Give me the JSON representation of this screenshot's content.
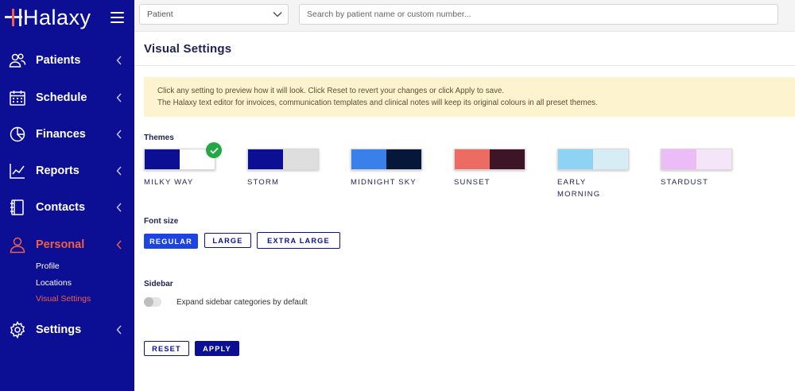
{
  "app": {
    "logo_text": "Halaxy"
  },
  "sidebar": {
    "items": [
      {
        "id": "patients",
        "label": "Patients",
        "icon": "users-icon"
      },
      {
        "id": "schedule",
        "label": "Schedule",
        "icon": "calendar-icon"
      },
      {
        "id": "finances",
        "label": "Finances",
        "icon": "pie-chart-icon"
      },
      {
        "id": "reports",
        "label": "Reports",
        "icon": "line-chart-icon"
      },
      {
        "id": "contacts",
        "label": "Contacts",
        "icon": "address-book-icon"
      },
      {
        "id": "personal",
        "label": "Personal",
        "icon": "person-icon",
        "active": true
      },
      {
        "id": "settings",
        "label": "Settings",
        "icon": "gear-icon"
      }
    ],
    "personal_sub_items": [
      {
        "label": "Profile",
        "active": false
      },
      {
        "label": "Locations",
        "active": false
      },
      {
        "label": "Visual Settings",
        "active": true
      }
    ]
  },
  "topbar": {
    "patient_select_value": "Patient",
    "search_placeholder": "Search by patient name or custom number..."
  },
  "page": {
    "title": "Visual Settings",
    "notice_line1": "Click any setting to preview how it will look. Click Reset to revert your changes or click Apply to save.",
    "notice_line2": "The Halaxy text editor for invoices, communication templates and clinical notes will keep its original colours in all preset themes."
  },
  "themes": {
    "label": "Themes",
    "selected": "MILKY WAY",
    "items": [
      {
        "name": "MILKY WAY",
        "color1": "#0c0f93",
        "color2": "#ffffff"
      },
      {
        "name": "STORM",
        "color1": "#0c0f93",
        "color2": "#dedede"
      },
      {
        "name": "MIDNIGHT SKY",
        "color1": "#3a80ea",
        "color2": "#07173a"
      },
      {
        "name": "SUNSET",
        "color1": "#ec6b62",
        "color2": "#3e1427"
      },
      {
        "name": "EARLY MORNING",
        "color1": "#8fd3f4",
        "color2": "#d6edf6"
      },
      {
        "name": "STARDUST",
        "color1": "#ecbcf6",
        "color2": "#f4e6f8"
      }
    ]
  },
  "font_size": {
    "label": "Font size",
    "options": [
      "REGULAR",
      "LARGE",
      "EXTRA LARGE"
    ],
    "selected": "REGULAR"
  },
  "sidebar_setting": {
    "label": "Sidebar",
    "toggle_label": "Expand sidebar categories by default",
    "toggle_on": false
  },
  "actions": {
    "reset_label": "RESET",
    "apply_label": "APPLY"
  },
  "colors": {
    "brand_navy": "#0c0f93",
    "accent_orange": "#f25e47",
    "primary_blue": "#1d44e0",
    "success_green": "#22a845",
    "notice_bg": "#fdf3cf"
  }
}
